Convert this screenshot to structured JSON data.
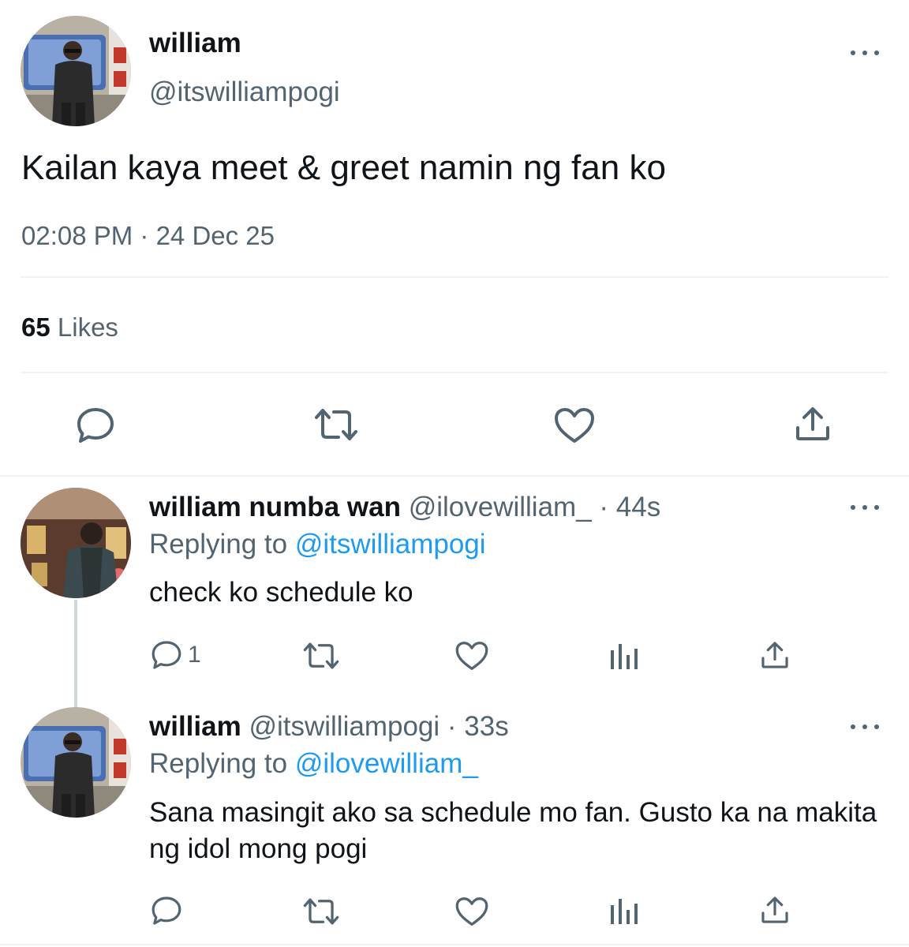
{
  "main_tweet": {
    "author_name": "william",
    "author_handle": "@itswilliampogi",
    "text": "Kailan kaya meet & greet namin ng fan ko",
    "timestamp": "02:08 PM · 24 Dec 25",
    "likes_count": "65",
    "likes_label": "Likes",
    "icons": [
      "reply-icon",
      "retweet-icon",
      "like-icon",
      "share-icon"
    ]
  },
  "replies": [
    {
      "author_name": "william numba wan",
      "author_handle": "@ilovewilliam_",
      "time": "· 44s",
      "replying_prefix": "Replying to",
      "replying_to": "@itswilliampogi",
      "text": "check ko schedule ko",
      "reply_count": "1"
    },
    {
      "author_name": "william",
      "author_handle": "@itswilliampogi",
      "time": "· 33s",
      "replying_prefix": "Replying to",
      "replying_to": "@ilovewilliam_",
      "text": "Sana masingit ako sa schedule mo fan. Gusto ka na makita ng idol mong pogi",
      "reply_count": ""
    }
  ],
  "colors": {
    "text_primary": "#0f1419",
    "text_secondary": "#536471",
    "link": "#1d9bf0",
    "divider": "#eff3f4"
  }
}
